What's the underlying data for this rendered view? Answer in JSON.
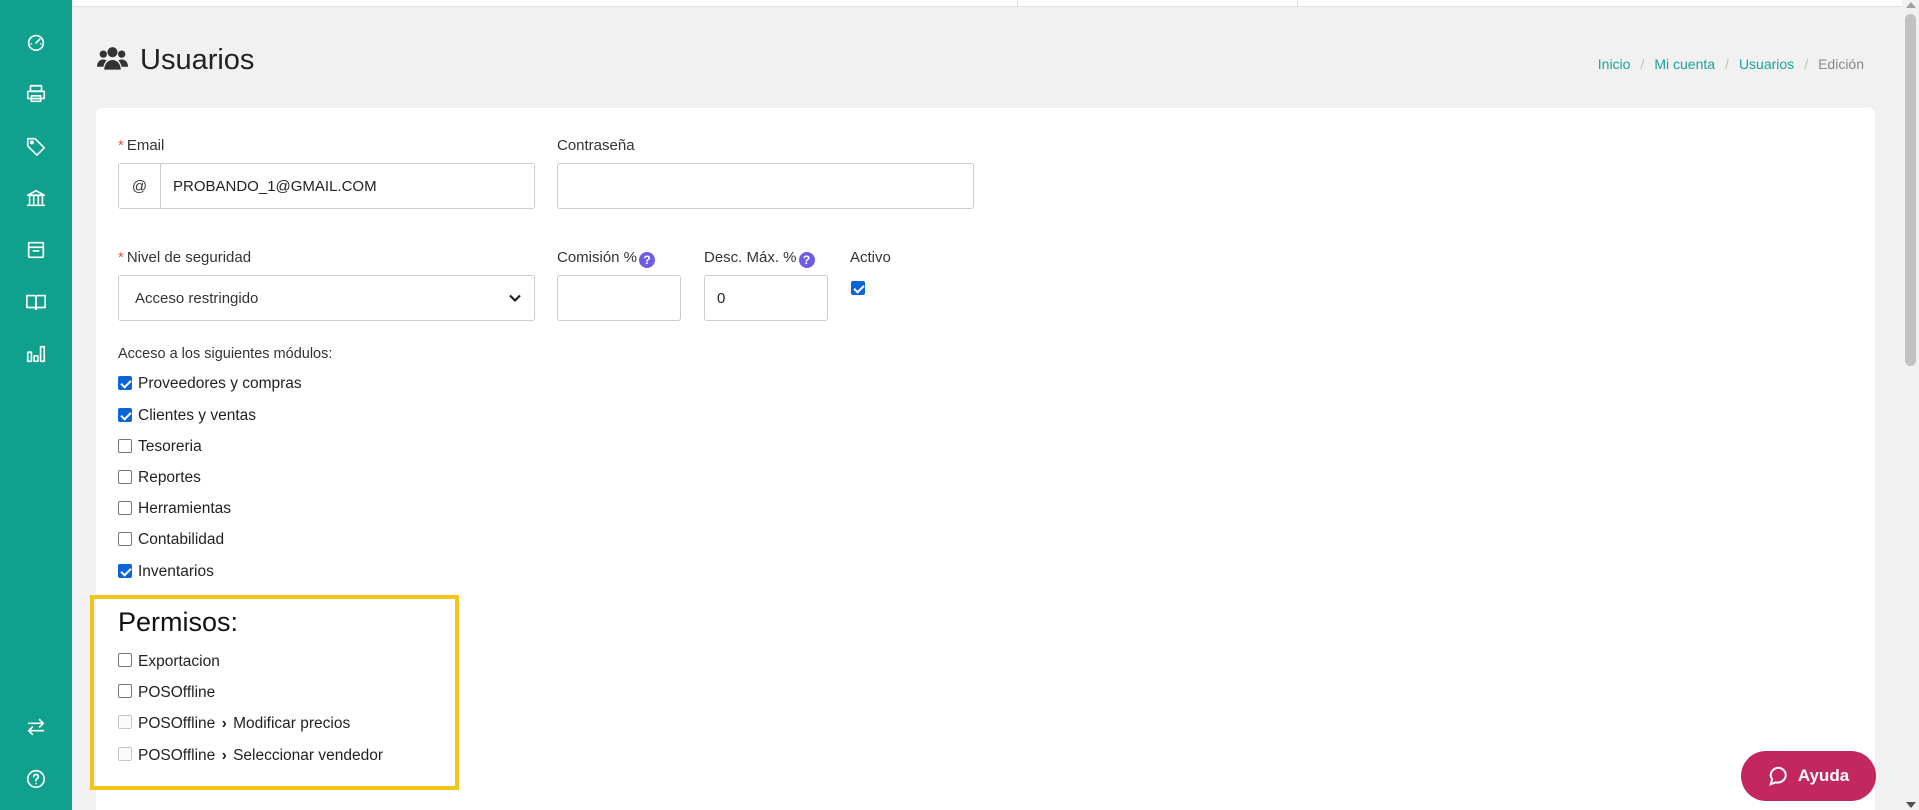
{
  "sidebar": {
    "items": [
      {
        "icon": "dashboard-gauge-icon"
      },
      {
        "icon": "printer-icon"
      },
      {
        "icon": "tag-icon"
      },
      {
        "icon": "bank-icon"
      },
      {
        "icon": "archive-box-icon"
      },
      {
        "icon": "book-open-icon"
      },
      {
        "icon": "bar-chart-icon"
      }
    ],
    "bottom_items": [
      {
        "icon": "swap-arrows-icon"
      },
      {
        "icon": "help-circle-icon"
      }
    ]
  },
  "header": {
    "title": "Usuarios",
    "icon": "users-icon"
  },
  "breadcrumb": {
    "items": [
      "Inicio",
      "Mi cuenta",
      "Usuarios"
    ],
    "current": "Edición",
    "separator": "/"
  },
  "form": {
    "email": {
      "label": "Email",
      "required_mark": "*",
      "addon": "@",
      "value": "PROBANDO_1@GMAIL.COM"
    },
    "password": {
      "label": "Contraseña",
      "value": ""
    },
    "security_level": {
      "label": "Nivel de seguridad",
      "required_mark": "*",
      "value": "Acceso restringido"
    },
    "commission": {
      "label": "Comisión %",
      "help": "?",
      "value": ""
    },
    "max_discount": {
      "label": "Desc. Máx. %",
      "help": "?",
      "value": "0"
    },
    "active": {
      "label": "Activo",
      "checked": true
    }
  },
  "modules": {
    "title": "Acceso a los siguientes módulos:",
    "items": [
      {
        "label": "Proveedores y compras",
        "checked": true
      },
      {
        "label": "Clientes y ventas",
        "checked": true
      },
      {
        "label": "Tesoreria",
        "checked": false
      },
      {
        "label": "Reportes",
        "checked": false
      },
      {
        "label": "Herramientas",
        "checked": false
      },
      {
        "label": "Contabilidad",
        "checked": false
      },
      {
        "label": "Inventarios",
        "checked": true
      }
    ]
  },
  "permissions": {
    "title": "Permisos:",
    "items": [
      {
        "label": "Exportacion",
        "checked": false,
        "disabled": false
      },
      {
        "label": "POSOffline",
        "checked": false,
        "disabled": false
      },
      {
        "label": "POSOffline",
        "sub": "Modificar precios",
        "checked": false,
        "disabled": true
      },
      {
        "label": "POSOffline",
        "sub": "Seleccionar vendedor",
        "checked": false,
        "disabled": true
      }
    ],
    "highlight_color": "#f2c51a"
  },
  "help_button": {
    "label": "Ayuda",
    "icon": "chat-bubble-icon"
  },
  "colors": {
    "sidebar": "#0fa18d",
    "link": "#17a594",
    "checkbox": "#0a66d8",
    "help_button": "#c2275f",
    "help_badge": "#6f5ce6"
  }
}
